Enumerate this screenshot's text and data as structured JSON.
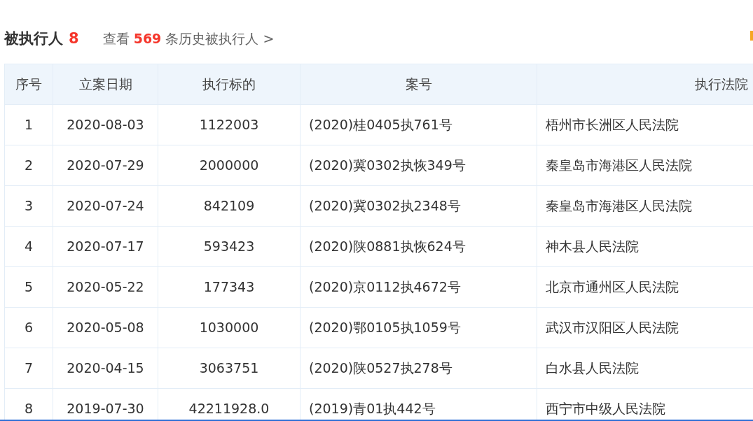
{
  "header": {
    "title": "被执行人",
    "count": "8",
    "history_prefix": "查看",
    "history_count": "569",
    "history_suffix": "条历史被执行人",
    "history_arrow": ">"
  },
  "table": {
    "columns": [
      "序号",
      "立案日期",
      "执行标的",
      "案号",
      "执行法院"
    ],
    "rows": [
      [
        "1",
        "2020-08-03",
        "1122003",
        "(2020)桂0405执761号",
        "梧州市长洲区人民法院"
      ],
      [
        "2",
        "2020-07-29",
        "2000000",
        "(2020)冀0302执恢349号",
        "秦皇岛市海港区人民法院"
      ],
      [
        "3",
        "2020-07-24",
        "842109",
        "(2020)冀0302执2348号",
        "秦皇岛市海港区人民法院"
      ],
      [
        "4",
        "2020-07-17",
        "593423",
        "(2020)陕0881执恢624号",
        "神木县人民法院"
      ],
      [
        "5",
        "2020-05-22",
        "177343",
        "(2020)京0112执4672号",
        "北京市通州区人民法院"
      ],
      [
        "6",
        "2020-05-08",
        "1030000",
        "(2020)鄂0105执1059号",
        "武汉市汉阳区人民法院"
      ],
      [
        "7",
        "2020-04-15",
        "3063751",
        "(2020)陕0527执278号",
        "白水县人民法院"
      ],
      [
        "8",
        "2019-07-30",
        "42211928.0",
        "(2019)青01执442号",
        "西宁市中级人民法院"
      ]
    ]
  }
}
